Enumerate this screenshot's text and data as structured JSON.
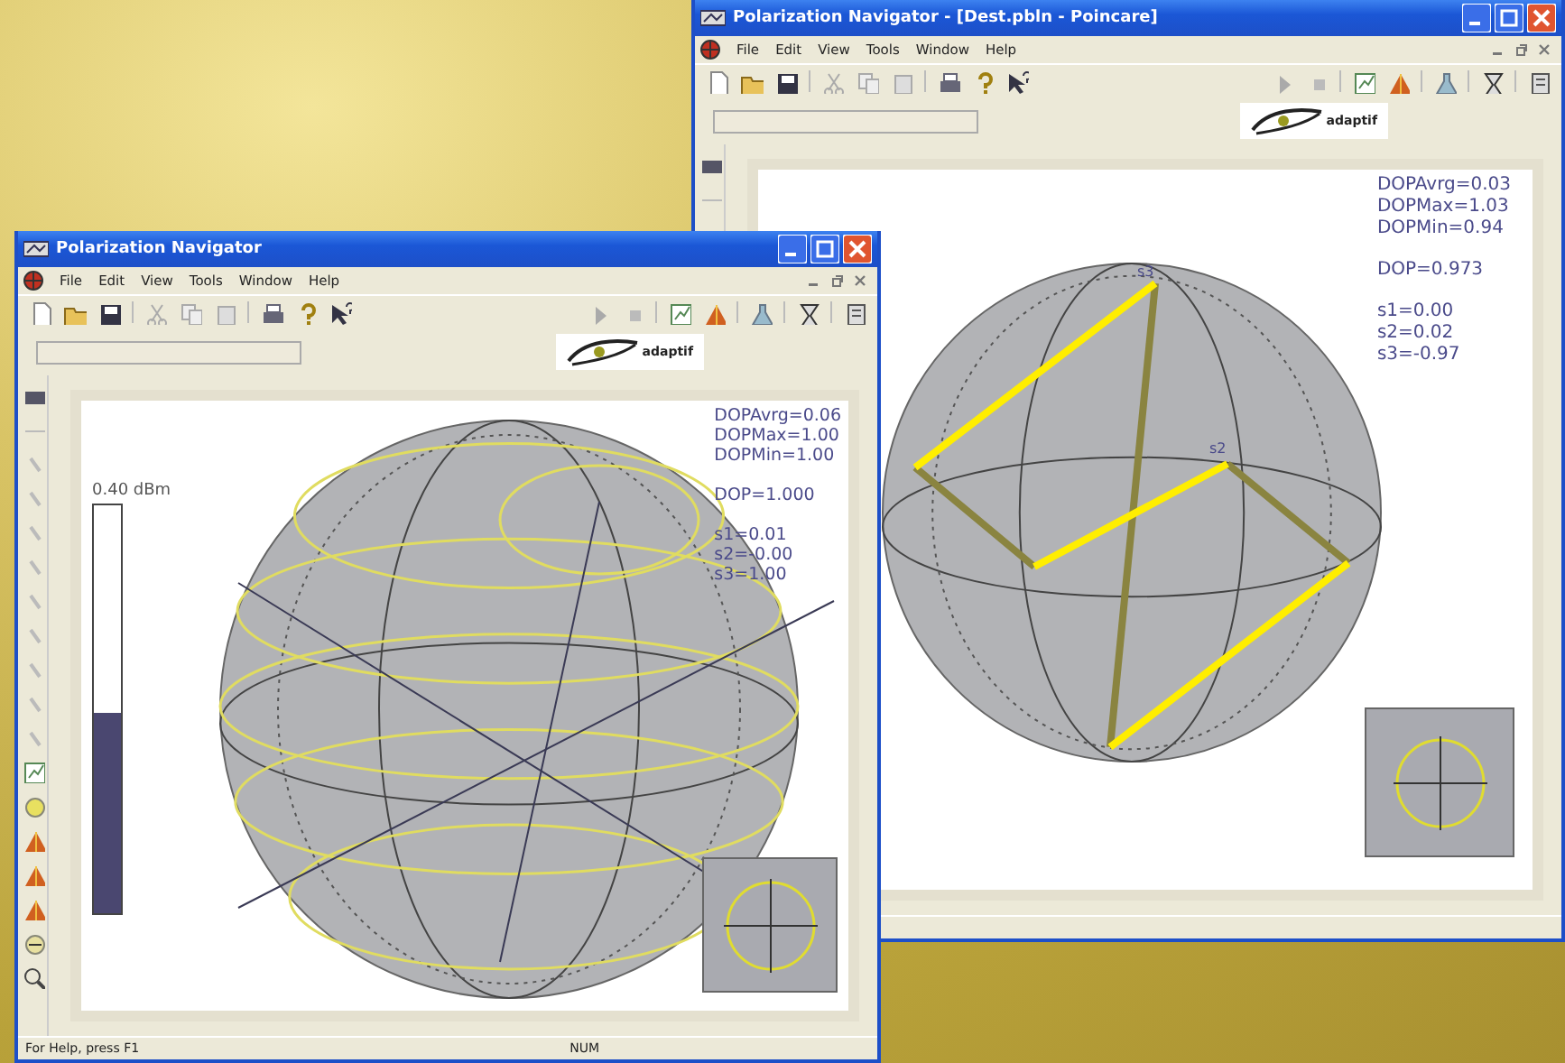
{
  "windows": [
    {
      "kind": "trace",
      "title": "Polarization Navigator - [Dest.pbln - Poincare]",
      "menu": [
        "File",
        "Edit",
        "View",
        "Tools",
        "Window",
        "Help"
      ],
      "logo": "adaptif",
      "readouts": [
        [
          "DOPAvrg=0.03",
          "DOPMax=1.03",
          "DOPMin=0.94"
        ],
        [
          "DOP=0.973"
        ],
        [
          "s1=0.00",
          "s2=0.02",
          "s3=-0.97"
        ]
      ],
      "sphere_labels": [
        "s3",
        "s2"
      ]
    },
    {
      "kind": "circles",
      "title": "Polarization Navigator",
      "menu": [
        "File",
        "Edit",
        "View",
        "Tools",
        "Window",
        "Help"
      ],
      "logo": "adaptif",
      "readouts": [
        [
          "DOPAvrg=0.06",
          "DOPMax=1.00",
          "DOPMin=1.00"
        ],
        [
          "DOP=1.000"
        ],
        [
          "s1=0.01",
          "s2=-0.00",
          "s3=1.00"
        ]
      ],
      "power": {
        "reading": "0.40 dBm",
        "level": 0.49
      },
      "status_bar": {
        "message": "For Help, press F1",
        "indicator": "NUM"
      }
    }
  ]
}
